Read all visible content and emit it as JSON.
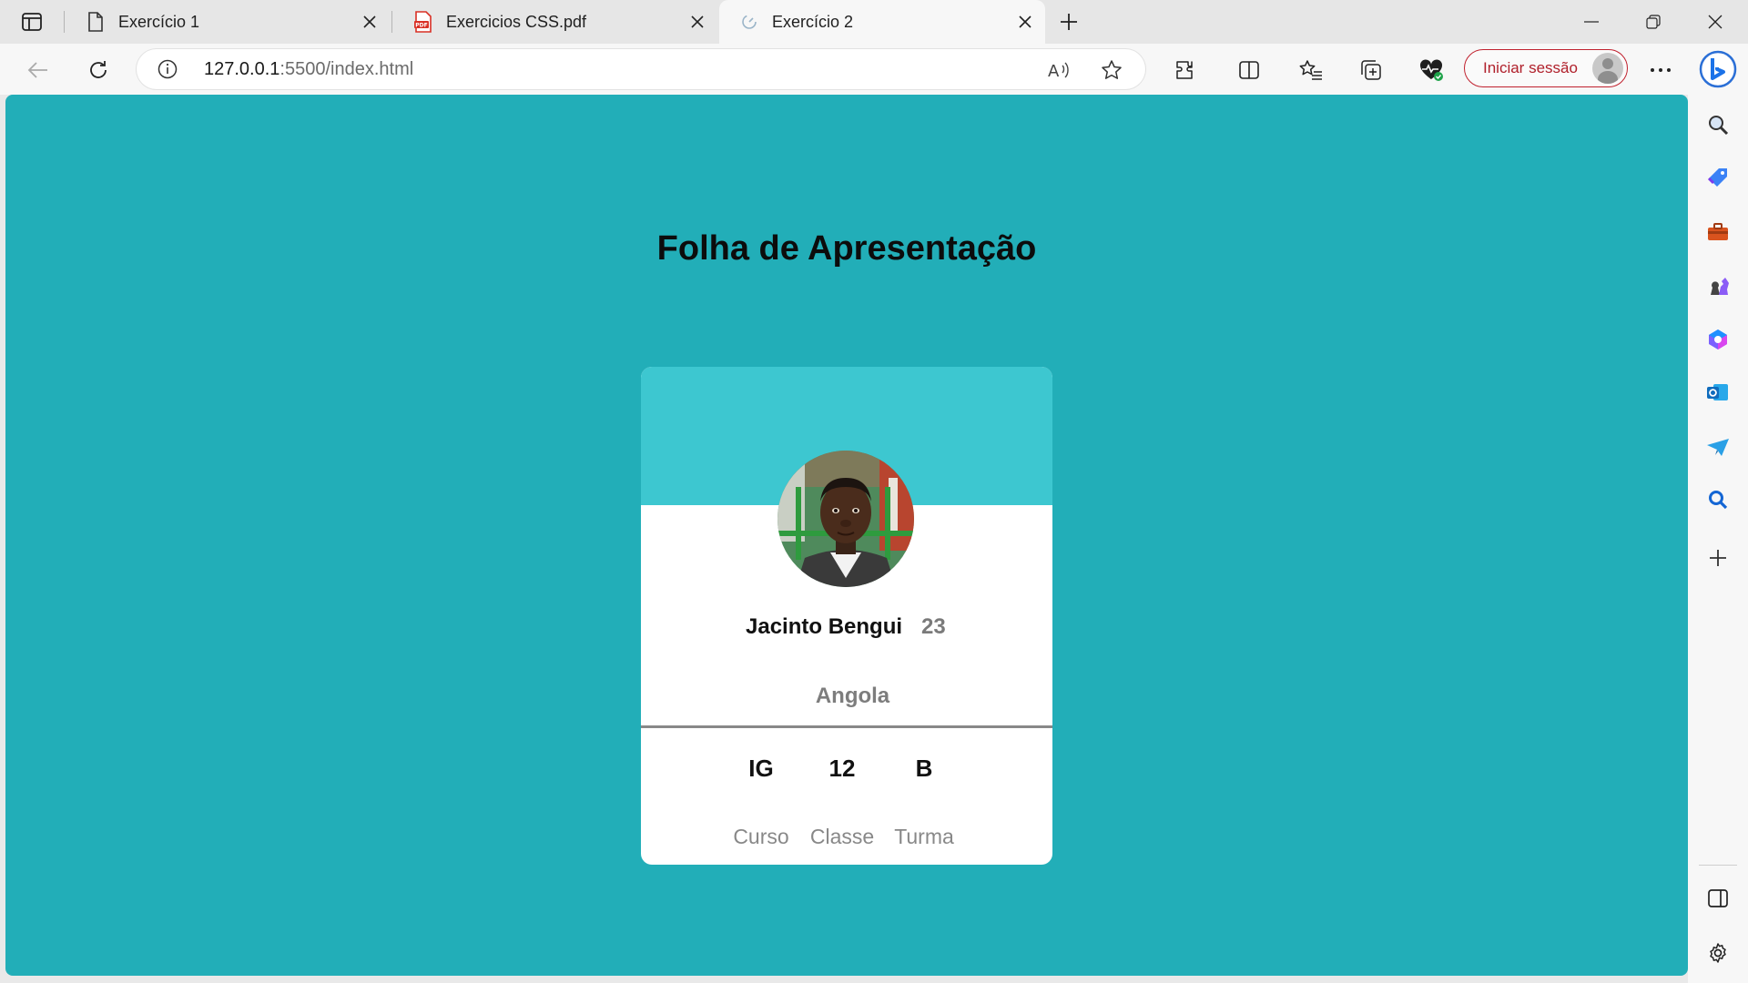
{
  "browser": {
    "tabs": [
      {
        "title": "Exercício 1",
        "icon": "page-icon",
        "active": false
      },
      {
        "title": "Exercicios CSS.pdf",
        "icon": "pdf-icon",
        "active": false
      },
      {
        "title": "Exercício 2",
        "icon": "live-server-icon",
        "active": true
      }
    ],
    "address": {
      "host": "127.0.0.1",
      "path": ":5500/index.html"
    },
    "signin_label": "Iniciar sessão",
    "colors": {
      "signin_accent": "#c0212e",
      "chrome": "#f7f7f7",
      "tabstrip": "#e6e6e6"
    }
  },
  "page": {
    "title": "Folha de Apresentação",
    "background": "#22aeb8",
    "card": {
      "header_color": "#3dc7d0",
      "name": "Jacinto Bengui",
      "age": "23",
      "country": "Angola",
      "stats": [
        {
          "value": "IG",
          "label": "Curso"
        },
        {
          "value": "12",
          "label": "Classe"
        },
        {
          "value": "B",
          "label": "Turma"
        }
      ]
    }
  }
}
